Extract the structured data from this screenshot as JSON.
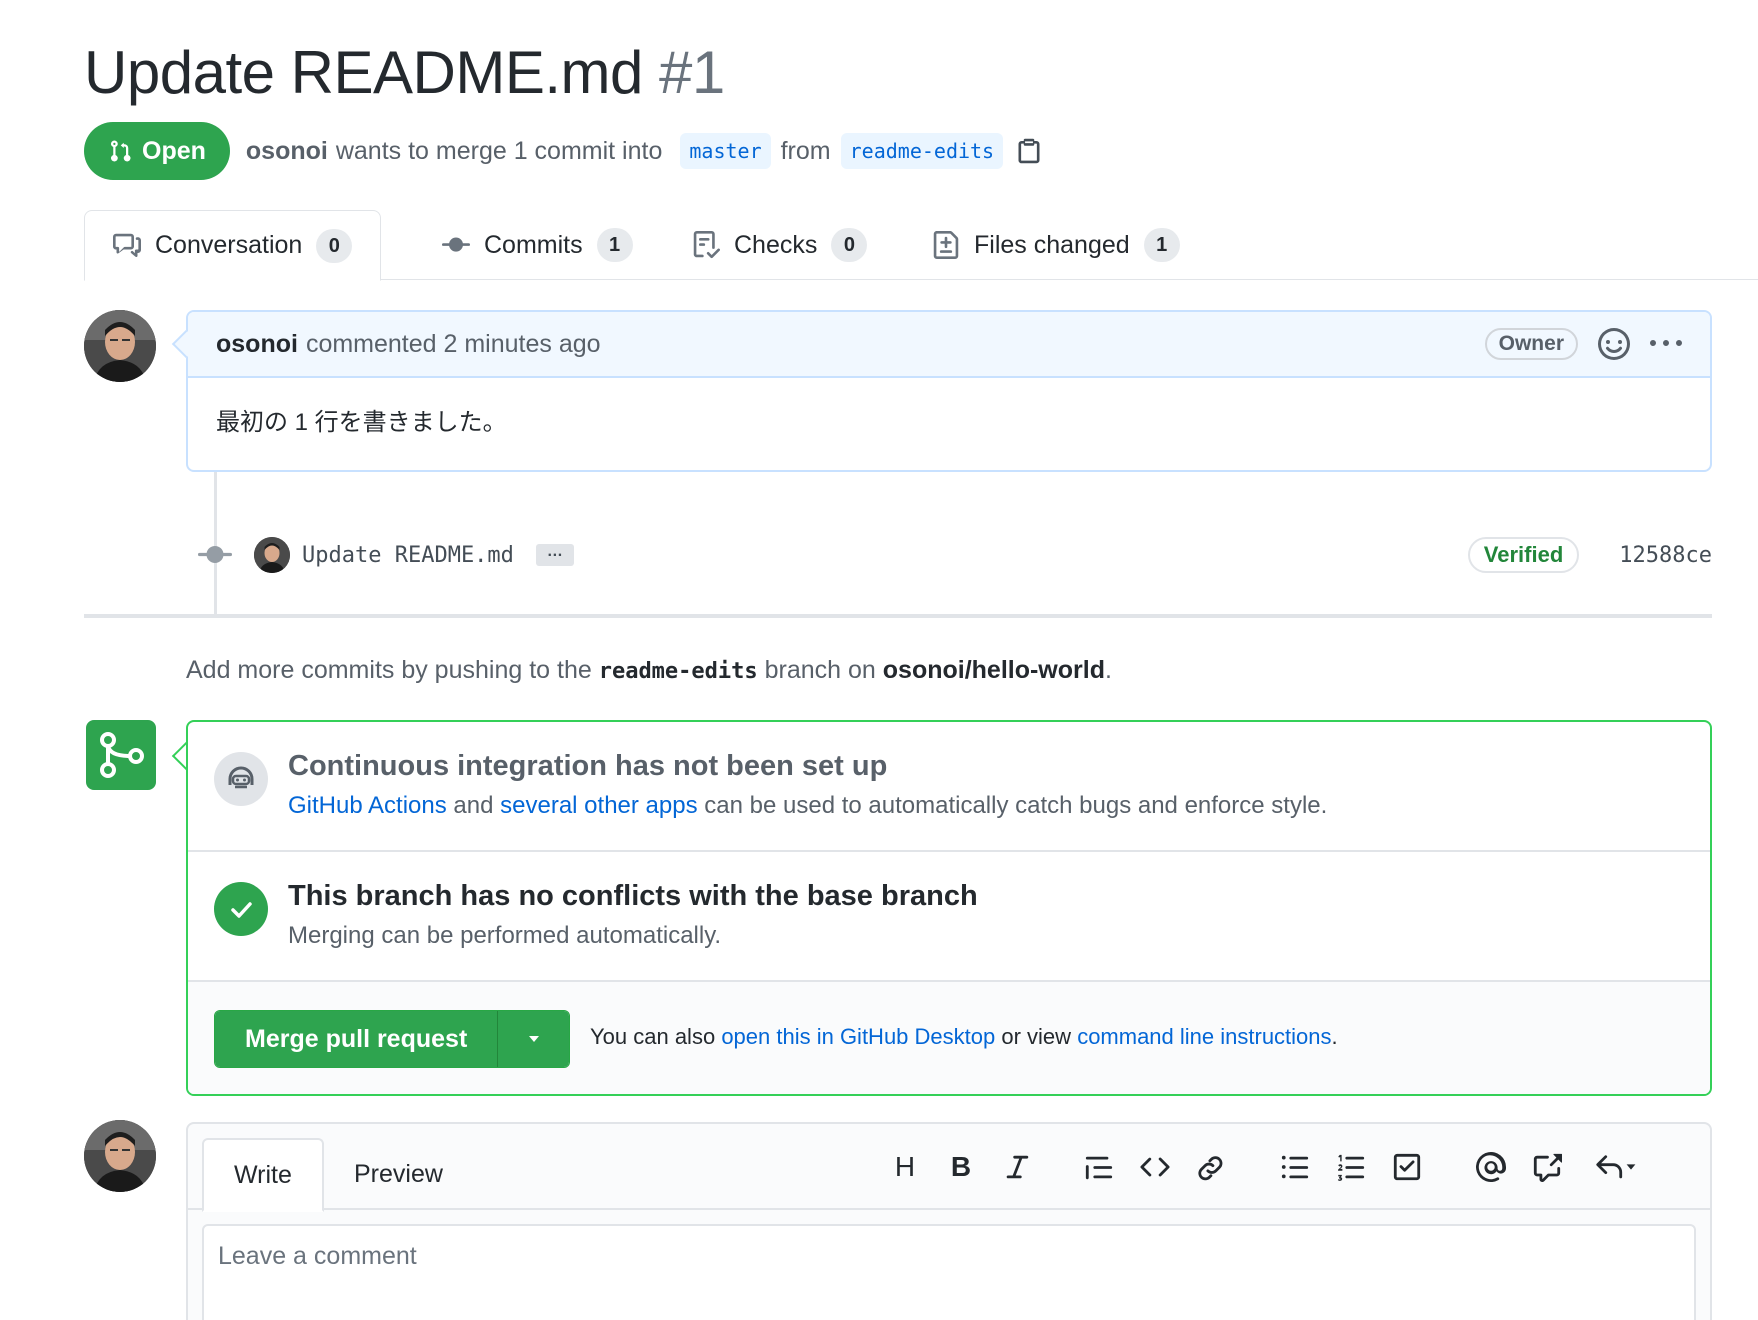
{
  "pr": {
    "title": "Update README.md",
    "number": "#1",
    "state": "Open",
    "author": "osonoi",
    "merge_text": "wants to merge 1 commit into",
    "base_branch": "master",
    "from_text": "from",
    "head_branch": "readme-edits"
  },
  "tabs": [
    {
      "label": "Conversation",
      "count": "0",
      "icon": "comment-discussion-icon"
    },
    {
      "label": "Commits",
      "count": "1",
      "icon": "git-commit-icon"
    },
    {
      "label": "Checks",
      "count": "0",
      "icon": "checklist-icon"
    },
    {
      "label": "Files changed",
      "count": "1",
      "icon": "file-diff-icon"
    }
  ],
  "comment": {
    "author": "osonoi",
    "action": "commented 2 minutes ago",
    "badge": "Owner",
    "body": "最初の 1 行を書きました。"
  },
  "commit": {
    "message": "Update README.md",
    "ellipsis": "…",
    "verified": "Verified",
    "sha": "12588ce"
  },
  "push_hint": {
    "prefix": "Add more commits by pushing to the",
    "branch": "readme-edits",
    "middle": "branch on",
    "repo": "osonoi/hello-world",
    "suffix": "."
  },
  "checks": {
    "ci_title": "Continuous integration has not been set up",
    "ci_link1": "GitHub Actions",
    "ci_and": "and",
    "ci_link2": "several other apps",
    "ci_rest": "can be used to automatically catch bugs and enforce style.",
    "conflict_title": "This branch has no conflicts with the base branch",
    "conflict_sub": "Merging can be performed automatically."
  },
  "merge": {
    "button": "Merge pull request",
    "hint_prefix": "You can also",
    "hint_link1": "open this in GitHub Desktop",
    "hint_mid": "or view",
    "hint_link2": "command line instructions",
    "hint_suffix": "."
  },
  "editor": {
    "tab_write": "Write",
    "tab_preview": "Preview",
    "heading_tool": "H",
    "bold_tool": "B",
    "placeholder": "Leave a comment"
  },
  "colors": {
    "green": "#2ea44f",
    "link": "#0366d6",
    "border": "#e1e4e8"
  }
}
